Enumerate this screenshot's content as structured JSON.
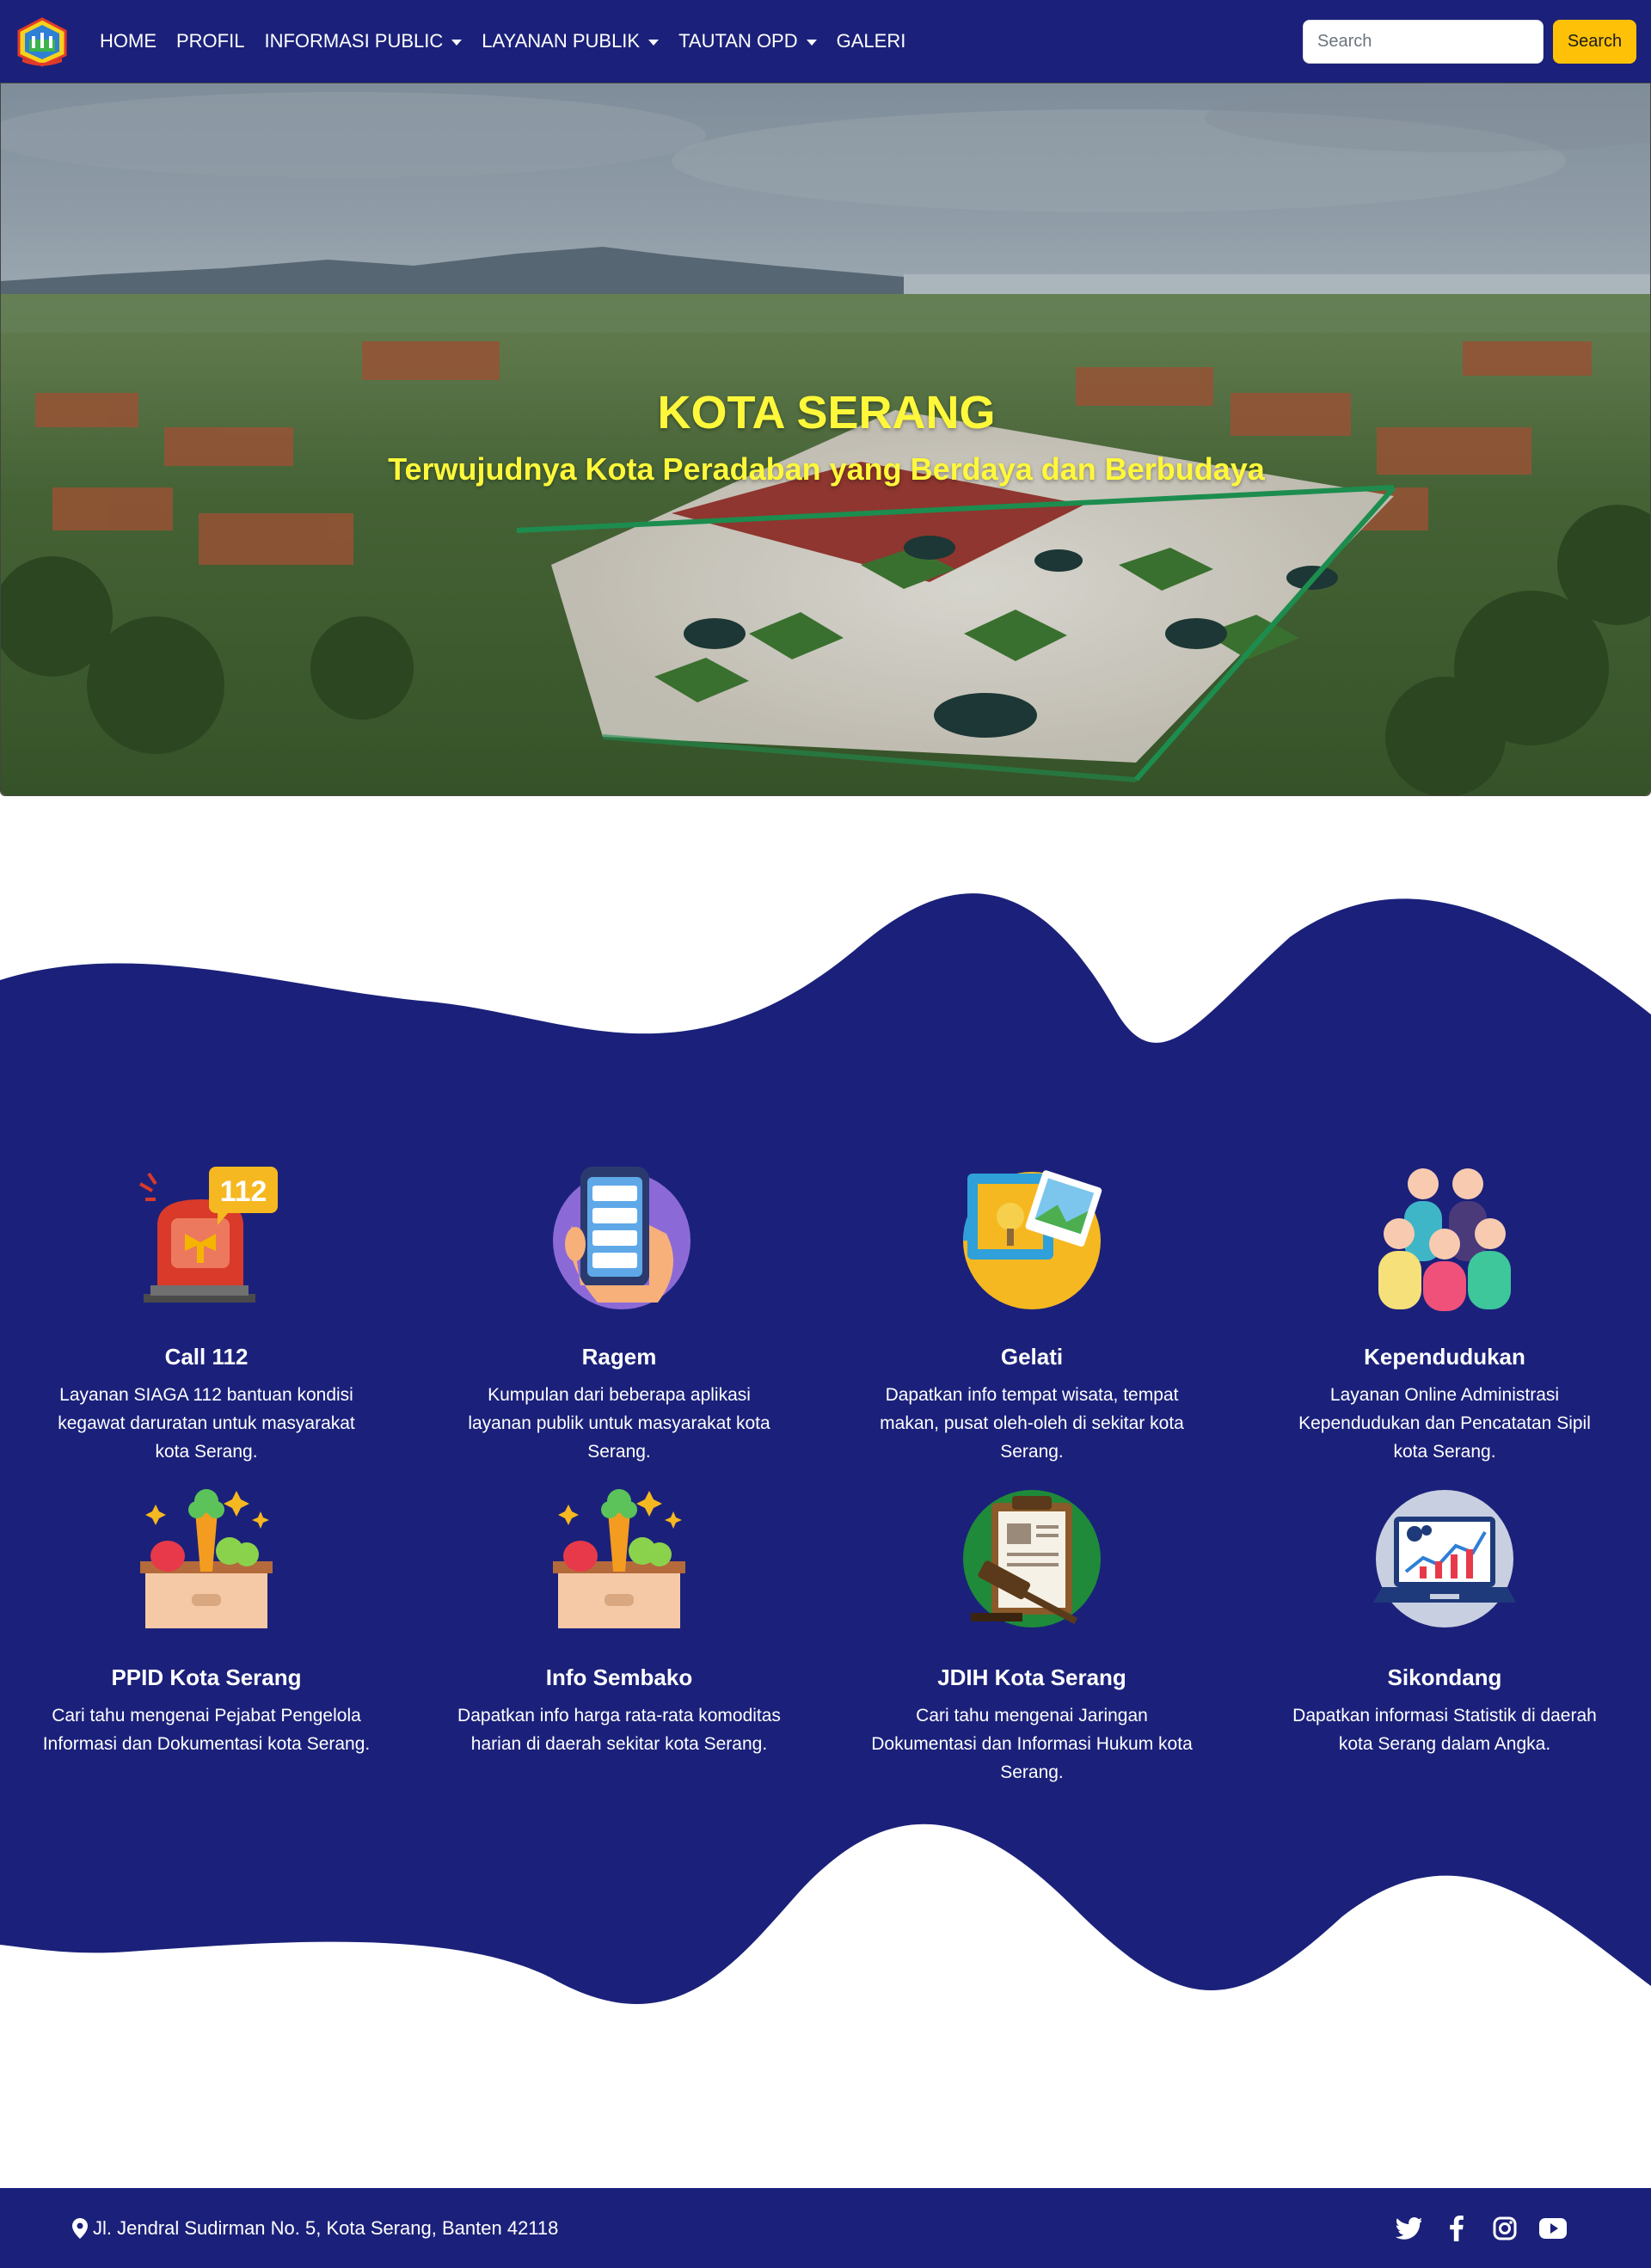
{
  "nav": {
    "items": [
      {
        "label": "HOME",
        "dropdown": false
      },
      {
        "label": "PROFIL",
        "dropdown": false
      },
      {
        "label": "INFORMASI PUBLIC",
        "dropdown": true
      },
      {
        "label": "LAYANAN PUBLIK",
        "dropdown": true
      },
      {
        "label": "TAUTAN OPD",
        "dropdown": true
      },
      {
        "label": "GALERI",
        "dropdown": false
      }
    ],
    "search_placeholder": "Search",
    "search_button": "Search"
  },
  "hero": {
    "title": "KOTA SERANG",
    "subtitle": "Terwujudnya Kota Peradaban yang Berdaya dan Berbudaya"
  },
  "services": [
    {
      "title": "Call 112",
      "description": "Layanan SIAGA 112 bantuan kondisi kegawat daruratan untuk masyarakat kota Serang.",
      "icon": "siren-112-icon",
      "badge": "112"
    },
    {
      "title": "Ragem",
      "description": "Kumpulan dari beberapa aplikasi layanan publik untuk masyarakat kota Serang.",
      "icon": "phone-in-hand-icon"
    },
    {
      "title": "Gelati",
      "description": "Dapatkan info tempat wisata, tempat makan, pusat oleh-oleh di sekitar kota Serang.",
      "icon": "travel-photos-icon"
    },
    {
      "title": "Kependudukan",
      "description": "Layanan Online Administrasi Kependudukan dan Pencatatan Sipil kota Serang.",
      "icon": "people-group-icon"
    },
    {
      "title": "PPID Kota Serang",
      "description": "Cari tahu mengenai Pejabat Pengelola Informasi dan Dokumentasi kota Serang.",
      "icon": "vegetable-box-icon"
    },
    {
      "title": "Info Sembako",
      "description": "Dapatkan info harga rata-rata komoditas harian di daerah sekitar kota Serang.",
      "icon": "vegetable-box-icon"
    },
    {
      "title": "JDIH Kota Serang",
      "description": "Cari tahu mengenai Jaringan Dokumentasi dan Informasi Hukum kota Serang.",
      "icon": "gavel-document-icon"
    },
    {
      "title": "Sikondang",
      "description": "Dapatkan informasi Statistik di daerah kota Serang dalam Angka.",
      "icon": "laptop-chart-icon"
    }
  ],
  "footer": {
    "address": "Jl. Jendral Sudirman No. 5, Kota Serang, Banten 42118",
    "socials": [
      "twitter-icon",
      "facebook-icon",
      "instagram-icon",
      "youtube-icon"
    ]
  },
  "colors": {
    "navy": "#1b217a",
    "accent_yellow": "#ffc107",
    "hero_text": "#fff83a"
  }
}
